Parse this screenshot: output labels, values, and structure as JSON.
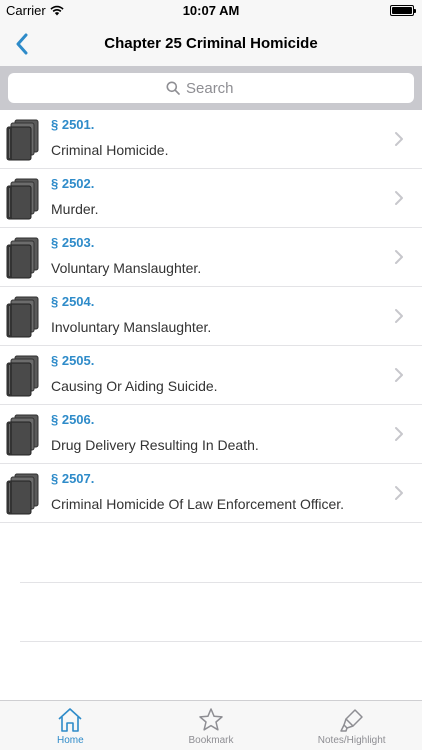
{
  "status_bar": {
    "carrier": "Carrier",
    "time": "10:07 AM"
  },
  "nav": {
    "title": "Chapter 25 Criminal Homicide"
  },
  "search": {
    "placeholder": "Search"
  },
  "sections": [
    {
      "number": "§ 2501.",
      "title": "Criminal Homicide."
    },
    {
      "number": "§ 2502.",
      "title": "Murder."
    },
    {
      "number": "§ 2503.",
      "title": "Voluntary Manslaughter."
    },
    {
      "number": "§ 2504.",
      "title": "Involuntary Manslaughter."
    },
    {
      "number": "§ 2505.",
      "title": "Causing Or Aiding Suicide."
    },
    {
      "number": "§ 2506.",
      "title": "Drug Delivery Resulting In Death."
    },
    {
      "number": "§ 2507.",
      "title": "Criminal Homicide Of Law Enforcement Officer."
    }
  ],
  "tabs": [
    {
      "label": "Home",
      "icon": "home-icon",
      "active": true
    },
    {
      "label": "Bookmark",
      "icon": "star-icon",
      "active": false
    },
    {
      "label": "Notes/Highlight",
      "icon": "highlighter-icon",
      "active": false
    }
  ],
  "colors": {
    "accent": "#2e8bc9",
    "inactive": "#8e8e93",
    "search_bg": "#c9c9ce"
  }
}
